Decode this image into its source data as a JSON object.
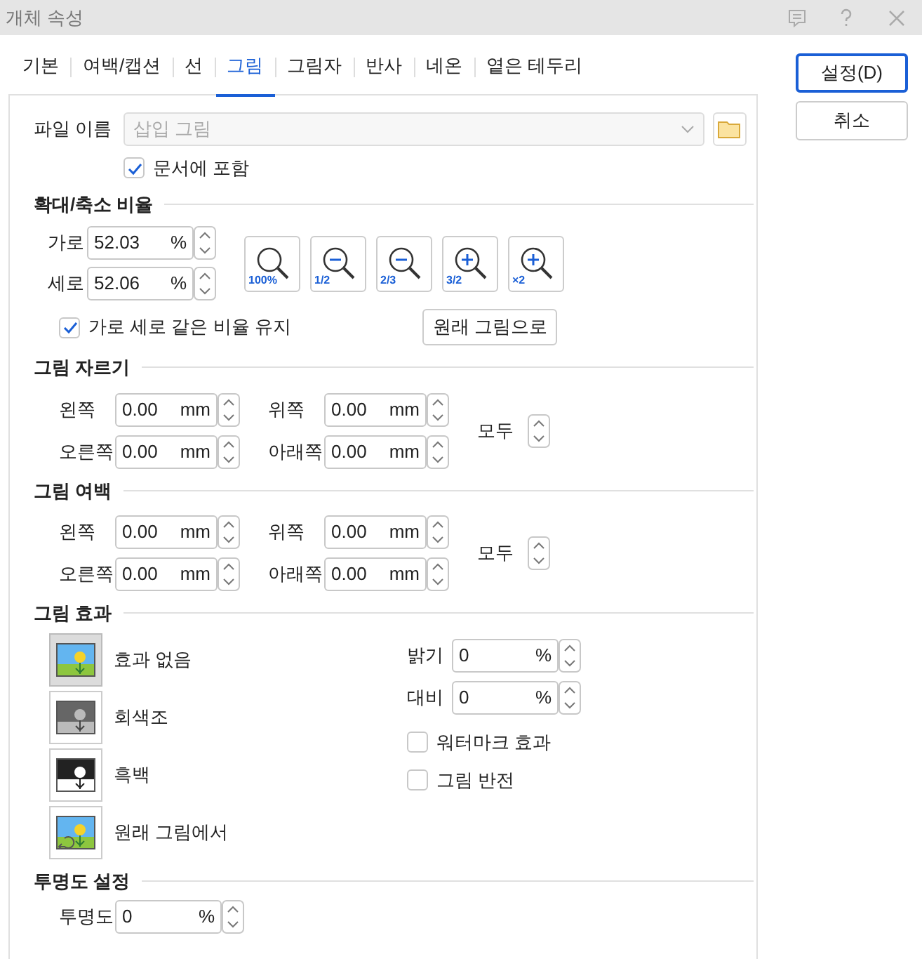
{
  "window": {
    "title": "개체 속성"
  },
  "tabs": [
    {
      "label": "기본",
      "selected": false
    },
    {
      "label": "여백/캡션",
      "selected": false
    },
    {
      "label": "선",
      "selected": false
    },
    {
      "label": "그림",
      "selected": true
    },
    {
      "label": "그림자",
      "selected": false
    },
    {
      "label": "반사",
      "selected": false
    },
    {
      "label": "네온",
      "selected": false
    },
    {
      "label": "옅은 테두리",
      "selected": false
    }
  ],
  "buttons": [
    {
      "label": "설정(D)",
      "default": true
    },
    {
      "label": "취소",
      "default": false
    }
  ],
  "file": {
    "label": "파일 이름",
    "value": "삽입 그림",
    "disabled": true
  },
  "include_in_document": {
    "label": "문서에 포함",
    "checked": true
  },
  "scale": {
    "title": "확대/축소 비율",
    "fields": [
      {
        "label": "가로",
        "value": "52.03",
        "unit": "%"
      },
      {
        "label": "세로",
        "value": "52.06",
        "unit": "%"
      }
    ],
    "zoom_buttons": [
      {
        "label": "100%",
        "kind": "actual"
      },
      {
        "label": "1/2",
        "kind": "out"
      },
      {
        "label": "2/3",
        "kind": "out"
      },
      {
        "label": "3/2",
        "kind": "in"
      },
      {
        "label": "×2",
        "kind": "in"
      }
    ],
    "keep_ratio": {
      "label": "가로 세로 같은 비율 유지",
      "checked": true
    },
    "original_button": "원래 그림으로"
  },
  "crop": {
    "title": "그림 자르기",
    "fields": [
      {
        "label": "왼쪽",
        "value": "0.00",
        "unit": "mm"
      },
      {
        "label": "위쪽",
        "value": "0.00",
        "unit": "mm"
      },
      {
        "label": "오른쪽",
        "value": "0.00",
        "unit": "mm"
      },
      {
        "label": "아래쪽",
        "value": "0.00",
        "unit": "mm"
      }
    ],
    "all_label": "모두"
  },
  "margin": {
    "title": "그림 여백",
    "fields": [
      {
        "label": "왼쪽",
        "value": "0.00",
        "unit": "mm"
      },
      {
        "label": "위쪽",
        "value": "0.00",
        "unit": "mm"
      },
      {
        "label": "오른쪽",
        "value": "0.00",
        "unit": "mm"
      },
      {
        "label": "아래쪽",
        "value": "0.00",
        "unit": "mm"
      }
    ],
    "all_label": "모두"
  },
  "effects": {
    "title": "그림 효과",
    "options": [
      {
        "label": "효과 없음",
        "kind": "color",
        "selected": true
      },
      {
        "label": "회색조",
        "kind": "gray",
        "selected": false
      },
      {
        "label": "흑백",
        "kind": "bw",
        "selected": false
      },
      {
        "label": "원래 그림에서",
        "kind": "original",
        "selected": false
      }
    ],
    "fields": [
      {
        "label": "밝기",
        "value": "0",
        "unit": "%"
      },
      {
        "label": "대비",
        "value": "0",
        "unit": "%"
      }
    ],
    "checks": [
      {
        "label": "워터마크 효과",
        "checked": false
      },
      {
        "label": "그림 반전",
        "checked": false
      }
    ]
  },
  "opacity": {
    "title": "투명도 설정",
    "field": {
      "label": "투명도",
      "value": "0",
      "unit": "%"
    }
  }
}
